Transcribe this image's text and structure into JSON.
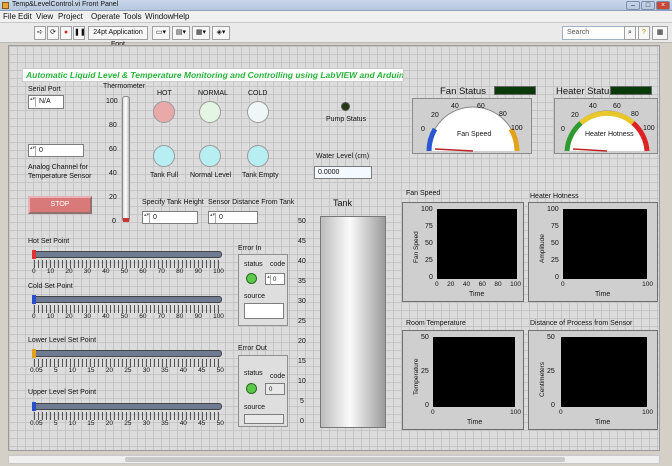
{
  "window": {
    "title": "Temp&LevelControl.vi Front Panel"
  },
  "menu": [
    "File",
    "Edit",
    "View",
    "Project",
    "Operate",
    "Tools",
    "Window",
    "Help"
  ],
  "toolbar": {
    "font": "24pt Application Font",
    "search_placeholder": "Search"
  },
  "banner": "Automatic Liquid Level & Temperature Monitoring and Controlling using LabVIEW and Arduino",
  "serial": {
    "label": "Serial Port",
    "value": "N/A"
  },
  "analog": {
    "value": "0",
    "label1": "Analog Channel for",
    "label2": "Temperature Sensor"
  },
  "stop_label": "STOP",
  "thermometer": {
    "label": "Thermometer",
    "ticks": [
      "100",
      "80",
      "60",
      "40",
      "20",
      "0"
    ]
  },
  "temp_leds": [
    "HOT",
    "NORMAL",
    "COLD"
  ],
  "tank_leds": [
    "Tank Full",
    "Normal Level",
    "Tank Empty"
  ],
  "pump_status": "Pump Status",
  "tank_height": {
    "label": "Specify Tank Height",
    "value": "0"
  },
  "sensor_distance": {
    "label": "Sensor Distance From Tank",
    "value": "0"
  },
  "water_level": {
    "label": "Water Level (cm)",
    "value": "0.0000"
  },
  "tank": {
    "label": "Tank",
    "ticks": [
      "50",
      "45",
      "40",
      "35",
      "30",
      "25",
      "20",
      "15",
      "10",
      "5",
      "0"
    ]
  },
  "hot_set": {
    "label": "Hot Set Point",
    "scale": [
      "0",
      "10",
      "20",
      "30",
      "40",
      "50",
      "60",
      "70",
      "80",
      "90",
      "100"
    ],
    "value": 0
  },
  "cold_set": {
    "label": "Cold Set Point",
    "scale": [
      "0",
      "10",
      "20",
      "30",
      "40",
      "50",
      "60",
      "70",
      "80",
      "90",
      "100"
    ],
    "value": 0
  },
  "lower_level": {
    "label": "Lower Level Set Point",
    "scale": [
      "0.05",
      "5",
      "10",
      "15",
      "20",
      "25",
      "30",
      "35",
      "40",
      "45",
      "50"
    ],
    "value": 0.05
  },
  "upper_level": {
    "label": "Upper Level  Set Point",
    "scale": [
      "0.05",
      "5",
      "10",
      "15",
      "20",
      "25",
      "30",
      "35",
      "40",
      "45",
      "50"
    ],
    "value": 0.05
  },
  "error_in": {
    "label": "Error In",
    "status": "status",
    "code": "code",
    "code_value": "0",
    "source": "source"
  },
  "error_out": {
    "label": "Error Out",
    "status": "status",
    "code": "code",
    "code_value": "0",
    "source": "source"
  },
  "fan_status": {
    "label": "Fan Status",
    "gauge_label": "Fan Speed",
    "ticks": [
      "0",
      "20",
      "40",
      "60",
      "80",
      "100"
    ]
  },
  "heater_status": {
    "label": "Heater Status",
    "gauge_label": "Heater Hotness",
    "ticks": [
      "0",
      "20",
      "40",
      "60",
      "80",
      "100"
    ]
  },
  "graphs": [
    {
      "title": "Fan Speed",
      "ylabel": "Fan Speed",
      "xlabel": "Time",
      "yticks": [
        "100",
        "75",
        "50",
        "25",
        "0"
      ],
      "xticks": [
        "0",
        "20",
        "40",
        "60",
        "80",
        "100"
      ]
    },
    {
      "title": "Heater Hotness",
      "ylabel": "Amplitude",
      "xlabel": "Time",
      "yticks": [
        "100",
        "75",
        "50",
        "25",
        "0"
      ],
      "xticks": [
        "0",
        "100"
      ]
    },
    {
      "title": "Room Temperature",
      "ylabel": "Temperature",
      "xlabel": "Time",
      "yticks": [
        "50",
        "25",
        "0"
      ],
      "xticks": [
        "0",
        "100"
      ]
    },
    {
      "title": "Distance of Process from Sensor",
      "ylabel": "Centimeters",
      "xlabel": "Time",
      "yticks": [
        "50",
        "25",
        "0"
      ],
      "xticks": [
        "0",
        "100"
      ]
    }
  ],
  "colors": {
    "banner_text": "#27b43a",
    "led_hot": "#e9a9a9",
    "led_on": "#b6eef2",
    "led_pale": "#e3f6e3",
    "stop": "#d97a7a"
  }
}
